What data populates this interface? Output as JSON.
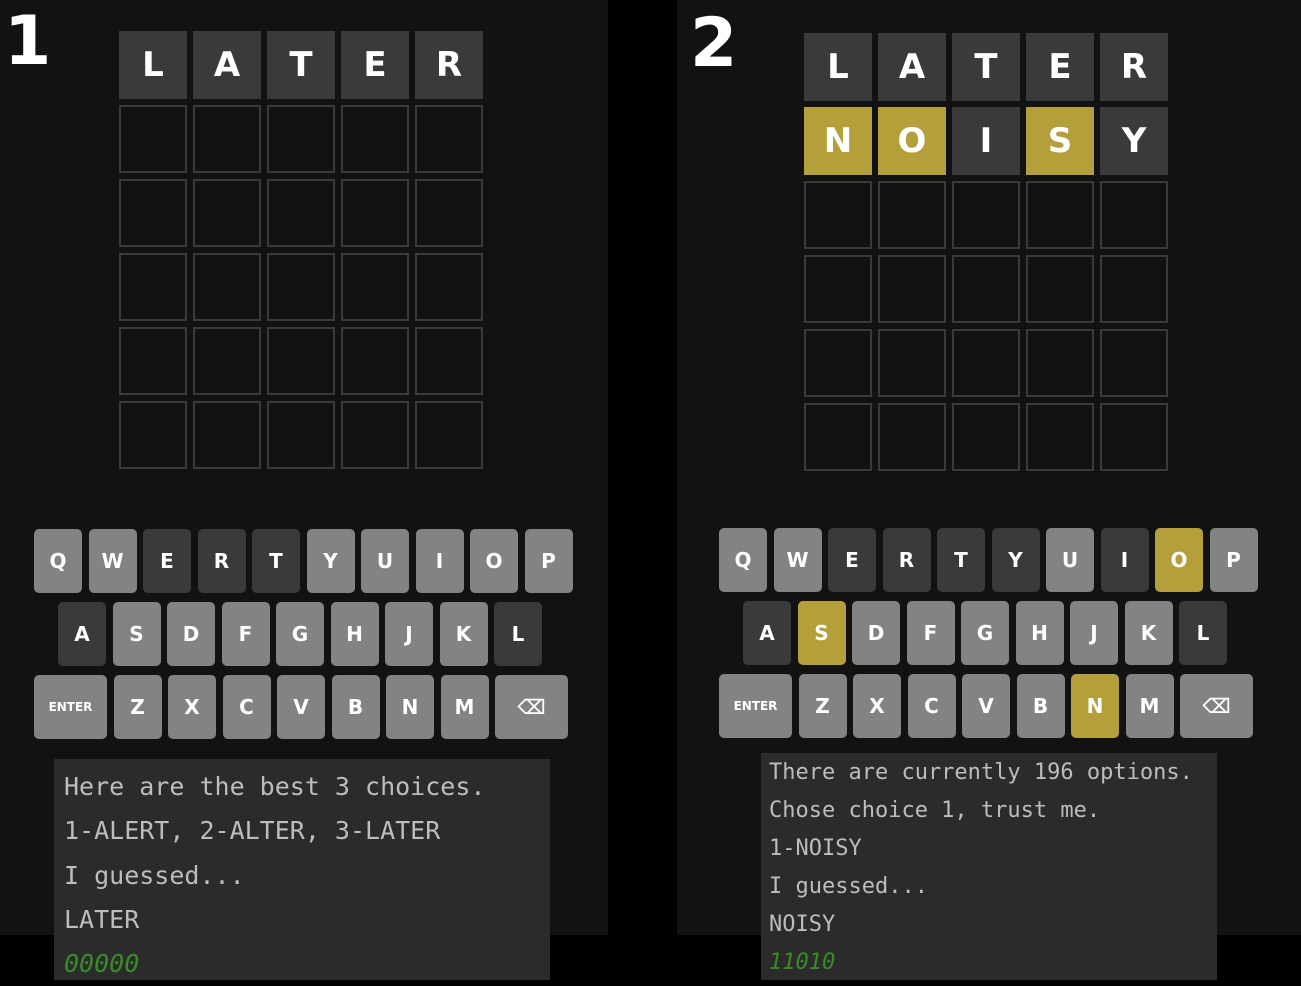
{
  "panels": [
    {
      "number": "1",
      "board": [
        {
          "letters": [
            "L",
            "A",
            "T",
            "E",
            "R"
          ],
          "states": [
            "absent",
            "absent",
            "absent",
            "absent",
            "absent"
          ]
        },
        {
          "letters": [
            "",
            "",
            "",
            "",
            ""
          ],
          "states": [
            "empty",
            "empty",
            "empty",
            "empty",
            "empty"
          ]
        },
        {
          "letters": [
            "",
            "",
            "",
            "",
            ""
          ],
          "states": [
            "empty",
            "empty",
            "empty",
            "empty",
            "empty"
          ]
        },
        {
          "letters": [
            "",
            "",
            "",
            "",
            ""
          ],
          "states": [
            "empty",
            "empty",
            "empty",
            "empty",
            "empty"
          ]
        },
        {
          "letters": [
            "",
            "",
            "",
            "",
            ""
          ],
          "states": [
            "empty",
            "empty",
            "empty",
            "empty",
            "empty"
          ]
        },
        {
          "letters": [
            "",
            "",
            "",
            "",
            ""
          ],
          "states": [
            "empty",
            "empty",
            "empty",
            "empty",
            "empty"
          ]
        }
      ],
      "key_states": {
        "E": "absent",
        "R": "absent",
        "T": "absent",
        "A": "absent",
        "L": "absent"
      },
      "console": [
        {
          "text": "Here are the best 3 choices.",
          "style": "text"
        },
        {
          "text": "1-ALERT, 2-ALTER, 3-LATER",
          "style": "text"
        },
        {
          "text": "I guessed...",
          "style": "text"
        },
        {
          "text": "LATER",
          "style": "text"
        },
        {
          "text": "00000",
          "style": "code"
        }
      ]
    },
    {
      "number": "2",
      "board": [
        {
          "letters": [
            "L",
            "A",
            "T",
            "E",
            "R"
          ],
          "states": [
            "absent",
            "absent",
            "absent",
            "absent",
            "absent"
          ]
        },
        {
          "letters": [
            "N",
            "O",
            "I",
            "S",
            "Y"
          ],
          "states": [
            "present",
            "present",
            "absent",
            "present",
            "absent"
          ]
        },
        {
          "letters": [
            "",
            "",
            "",
            "",
            ""
          ],
          "states": [
            "empty",
            "empty",
            "empty",
            "empty",
            "empty"
          ]
        },
        {
          "letters": [
            "",
            "",
            "",
            "",
            ""
          ],
          "states": [
            "empty",
            "empty",
            "empty",
            "empty",
            "empty"
          ]
        },
        {
          "letters": [
            "",
            "",
            "",
            "",
            ""
          ],
          "states": [
            "empty",
            "empty",
            "empty",
            "empty",
            "empty"
          ]
        },
        {
          "letters": [
            "",
            "",
            "",
            "",
            ""
          ],
          "states": [
            "empty",
            "empty",
            "empty",
            "empty",
            "empty"
          ]
        }
      ],
      "key_states": {
        "E": "absent",
        "R": "absent",
        "T": "absent",
        "Y": "absent",
        "I": "absent",
        "O": "present",
        "A": "absent",
        "S": "present",
        "L": "absent",
        "N": "present"
      },
      "console": [
        {
          "text": "There are currently 196 options.",
          "style": "text"
        },
        {
          "text": "Chose choice 1, trust me.",
          "style": "text"
        },
        {
          "text": "1-NOISY",
          "style": "text"
        },
        {
          "text": "I guessed...",
          "style": "text"
        },
        {
          "text": "NOISY",
          "style": "text"
        },
        {
          "text": "11010",
          "style": "code"
        }
      ]
    }
  ],
  "keyboard": {
    "rows": [
      [
        "Q",
        "W",
        "E",
        "R",
        "T",
        "Y",
        "U",
        "I",
        "O",
        "P"
      ],
      [
        "A",
        "S",
        "D",
        "F",
        "G",
        "H",
        "J",
        "K",
        "L"
      ],
      [
        "ENTER",
        "Z",
        "X",
        "C",
        "V",
        "B",
        "N",
        "M",
        "⌫"
      ]
    ]
  },
  "colors": {
    "absent": "#3a3a3c",
    "present": "#b59f3b",
    "unused": "#818384",
    "background": "#121213"
  }
}
